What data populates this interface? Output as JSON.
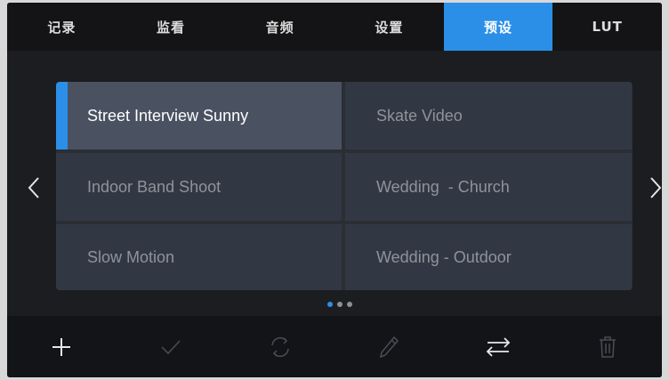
{
  "tabs": [
    {
      "label": "记录",
      "active": false
    },
    {
      "label": "监看",
      "active": false
    },
    {
      "label": "音频",
      "active": false
    },
    {
      "label": "设置",
      "active": false
    },
    {
      "label": "预设",
      "active": true
    },
    {
      "label": "LUT",
      "active": false
    }
  ],
  "presets": [
    {
      "label": "Street Interview Sunny",
      "selected": true
    },
    {
      "label": "Skate Video",
      "selected": false
    },
    {
      "label": "Indoor Band Shoot",
      "selected": false
    },
    {
      "label": "Wedding  - Church",
      "selected": false
    },
    {
      "label": "Slow Motion",
      "selected": false
    },
    {
      "label": "Wedding - Outdoor",
      "selected": false
    }
  ],
  "pagination": {
    "pages": 3,
    "current": 1
  },
  "toolbar": {
    "icons": [
      "add-icon",
      "check-icon",
      "refresh-icon",
      "pencil-icon",
      "transfer-icon",
      "trash-icon"
    ]
  },
  "colors": {
    "accent": "#2b8fe8",
    "background": "#1c1d20",
    "cell": "#323843",
    "cell_selected": "#4a5262"
  }
}
